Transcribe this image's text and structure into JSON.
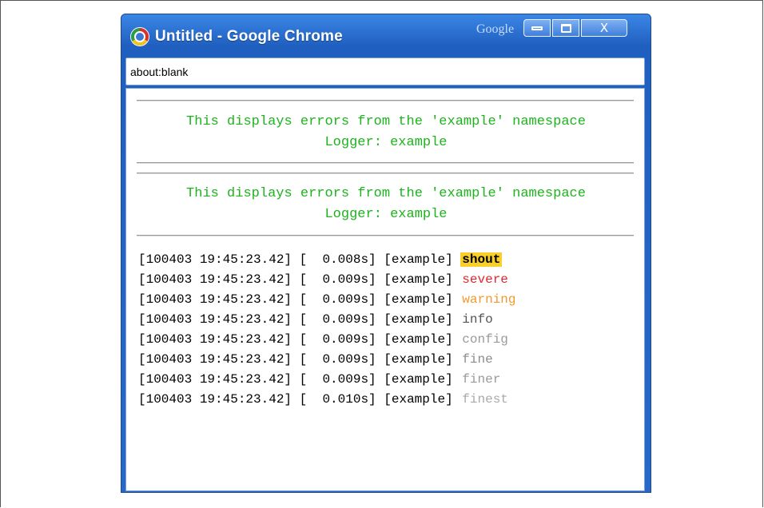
{
  "window": {
    "title": "Untitled - Google Chrome",
    "brand": "Google",
    "controls": {
      "minimize_icon": "minimize-icon",
      "maximize_icon": "maximize-icon",
      "close_label": "X"
    }
  },
  "address_bar": {
    "value": "about:blank"
  },
  "banners": [
    {
      "line1": "This displays errors from the 'example' namespace",
      "line2": "Logger: example"
    },
    {
      "line1": "This displays errors from the 'example' namespace",
      "line2": "Logger: example"
    }
  ],
  "log": [
    {
      "time": "[100403 19:45:23.42]",
      "elapsed": "[  0.008s]",
      "logger": "[example]",
      "level": "shout"
    },
    {
      "time": "[100403 19:45:23.42]",
      "elapsed": "[  0.009s]",
      "logger": "[example]",
      "level": "severe"
    },
    {
      "time": "[100403 19:45:23.42]",
      "elapsed": "[  0.009s]",
      "logger": "[example]",
      "level": "warning"
    },
    {
      "time": "[100403 19:45:23.42]",
      "elapsed": "[  0.009s]",
      "logger": "[example]",
      "level": "info"
    },
    {
      "time": "[100403 19:45:23.42]",
      "elapsed": "[  0.009s]",
      "logger": "[example]",
      "level": "config"
    },
    {
      "time": "[100403 19:45:23.42]",
      "elapsed": "[  0.009s]",
      "logger": "[example]",
      "level": "fine"
    },
    {
      "time": "[100403 19:45:23.42]",
      "elapsed": "[  0.009s]",
      "logger": "[example]",
      "level": "finer"
    },
    {
      "time": "[100403 19:45:23.42]",
      "elapsed": "[  0.010s]",
      "logger": "[example]",
      "level": "finest"
    }
  ],
  "colors": {
    "banner_text": "#1db31d",
    "shout_bg": "#f9cf2a",
    "severe": "#e3262e",
    "warning": "#f19a2c"
  }
}
